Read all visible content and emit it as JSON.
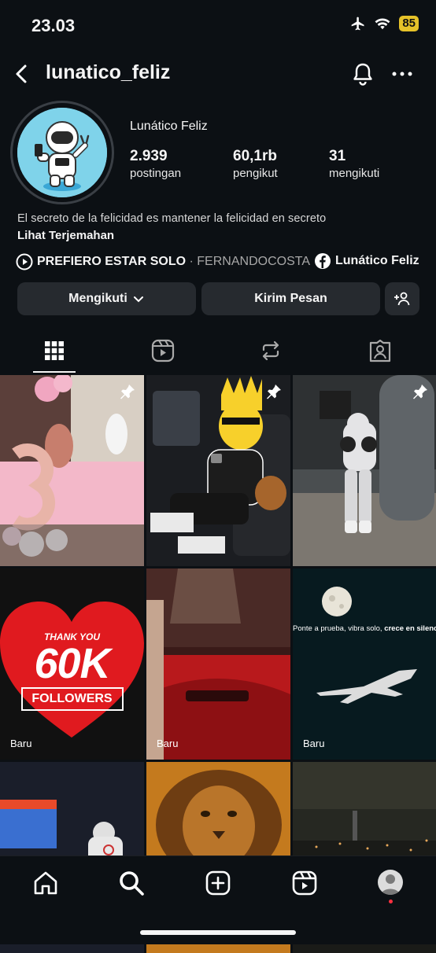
{
  "status_bar": {
    "time": "23.03",
    "battery": "85"
  },
  "header": {
    "username": "lunatico_feliz"
  },
  "profile": {
    "display_name": "Lunático Feliz",
    "stats": [
      {
        "value": "2.939",
        "label": "postingan"
      },
      {
        "value": "60,1rb",
        "label": "pengikut"
      },
      {
        "value": "31",
        "label": "mengikuti"
      }
    ],
    "bio": "El secreto de la felicidad es mantener la felicidad en secreto",
    "translate_link": "Lihat Terjemahan",
    "music": {
      "title": "PREFIERO ESTAR SOLO",
      "separator": " · ",
      "artist": "FERNANDOCOSTA"
    },
    "facebook_link": "Lunático Feliz"
  },
  "buttons": {
    "following": "Mengikuti",
    "message": "Kirim Pesan"
  },
  "grid": {
    "badge_new": "Baru",
    "post4": {
      "line1": "THANK YOU",
      "line2": "60K",
      "line3": "FOLLOWERS"
    },
    "post6": {
      "caption_normal": "Ponte a prueba, vibra solo, ",
      "caption_bold": "crece en silencio."
    }
  },
  "colors": {
    "background": "#0c1014",
    "button": "#262a2f",
    "heart": "#e01a1f",
    "notification_dot": "#ff3040"
  }
}
